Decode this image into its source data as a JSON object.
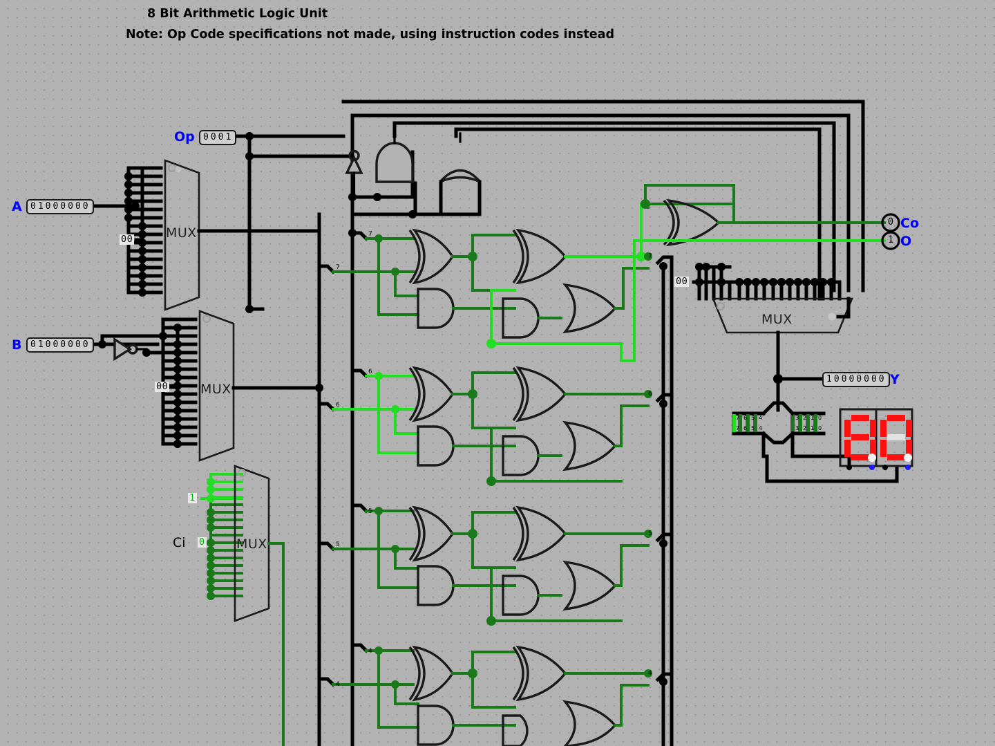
{
  "titles": {
    "line1": "8 Bit Arithmetic Logic Unit",
    "line2": "Note: Op Code specifications not made, using instruction codes instead"
  },
  "inputs": {
    "a": {
      "label": "A",
      "value": "01000000"
    },
    "b": {
      "label": "B",
      "value": "01000000"
    },
    "op": {
      "label": "Op",
      "value": "0001"
    },
    "ci": {
      "label": "Ci",
      "value": "0"
    },
    "const_one": {
      "value": "1"
    }
  },
  "outputs": {
    "co": {
      "label": "Co",
      "value": "0"
    },
    "o": {
      "label": "O",
      "value": "1"
    },
    "y": {
      "label": "Y",
      "value": "10000000"
    }
  },
  "muxes": [
    {
      "name": "mux-a",
      "label": "MUX",
      "select": "00"
    },
    {
      "name": "mux-b",
      "label": "MUX",
      "select": "00"
    },
    {
      "name": "mux-carry",
      "label": "MUX",
      "select": "0"
    },
    {
      "name": "mux-out",
      "label": "MUX",
      "select": "00"
    }
  ],
  "adder_rows": [
    {
      "bit_left": "7",
      "bit_left2": "7",
      "bit_right": "7"
    },
    {
      "bit_left": "6",
      "bit_left2": "6",
      "bit_right": "6"
    },
    {
      "bit_left": "5",
      "bit_left2": "5",
      "bit_right": "5"
    },
    {
      "bit_left": "4",
      "bit_left2": "4",
      "bit_right": "4"
    }
  ],
  "splitters": {
    "left": {
      "bits_top": [
        "7",
        "6",
        "5",
        "4"
      ],
      "bits_bottom": [
        "7",
        "6",
        "5",
        "4"
      ]
    },
    "right": {
      "bits_top": [
        "3",
        "2",
        "1",
        "0"
      ],
      "bits_bottom": [
        "3",
        "2",
        "1",
        "0"
      ]
    }
  },
  "seven_segment": {
    "digit_left": "8",
    "digit_right": "0",
    "on_color": "#ff1010",
    "off_color": "#e2e2e2"
  },
  "colors": {
    "background": "#b2b2b2",
    "wire_black": "#000000",
    "wire_low": "#1a7a1a",
    "wire_high": "#22dd22",
    "label_blue": "#0000ff",
    "grid_dot": "#8e8e8e"
  }
}
